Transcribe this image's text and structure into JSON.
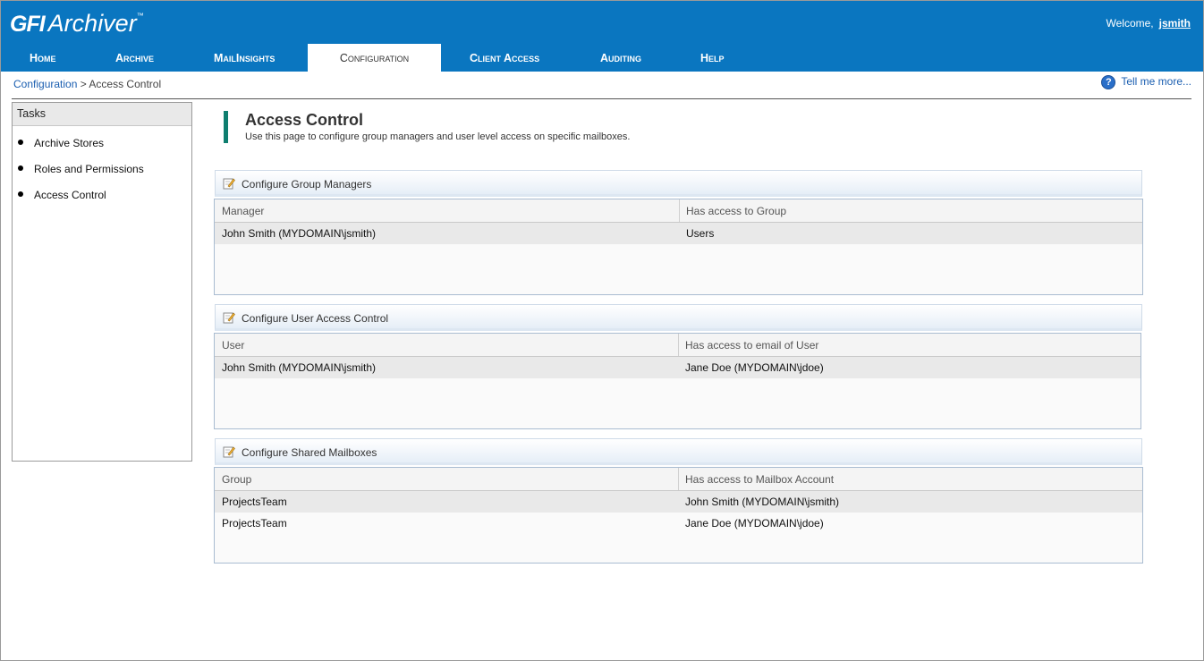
{
  "app": {
    "logo_gfi": "GFI",
    "logo_name": "Archiver",
    "logo_tm": "™"
  },
  "header": {
    "welcome_text": "Welcome,",
    "username": "jsmith"
  },
  "nav": {
    "tabs": [
      {
        "label": "Home"
      },
      {
        "label": "Archive"
      },
      {
        "label": "MailInsights"
      },
      {
        "label": "Configuration",
        "active": true
      },
      {
        "label": "Client Access"
      },
      {
        "label": "Auditing"
      },
      {
        "label": "Help"
      }
    ]
  },
  "breadcrumb": {
    "root": "Configuration",
    "separator": ">",
    "current": "Access Control"
  },
  "help_link": {
    "icon": "question-icon",
    "label": "Tell me more..."
  },
  "tasks": {
    "title": "Tasks",
    "items": [
      {
        "label": "Archive Stores"
      },
      {
        "label": "Roles and Permissions"
      },
      {
        "label": "Access Control"
      }
    ]
  },
  "page": {
    "title": "Access Control",
    "subtitle": "Use this page to configure group managers and user level access on specific mailboxes."
  },
  "sections": [
    {
      "title": "Configure Group Managers",
      "columns": [
        "Manager",
        "Has access to Group"
      ],
      "rows": [
        [
          "John Smith (MYDOMAIN\\jsmith)",
          "Users"
        ]
      ]
    },
    {
      "title": "Configure User Access Control",
      "columns": [
        "User",
        "Has access to email of User"
      ],
      "rows": [
        [
          "John Smith (MYDOMAIN\\jsmith)",
          "Jane Doe (MYDOMAIN\\jdoe)"
        ]
      ]
    },
    {
      "title": "Configure Shared Mailboxes",
      "columns": [
        "Group",
        "Has access to Mailbox Account"
      ],
      "rows": [
        [
          "ProjectsTeam",
          "John Smith (MYDOMAIN\\jsmith)"
        ],
        [
          "ProjectsTeam",
          "Jane Doe (MYDOMAIN\\jdoe)"
        ]
      ]
    }
  ],
  "colors": {
    "header_blue": "#0a76c0",
    "title_accent": "#0e7e6f",
    "link_blue": "#1a5eb0"
  }
}
